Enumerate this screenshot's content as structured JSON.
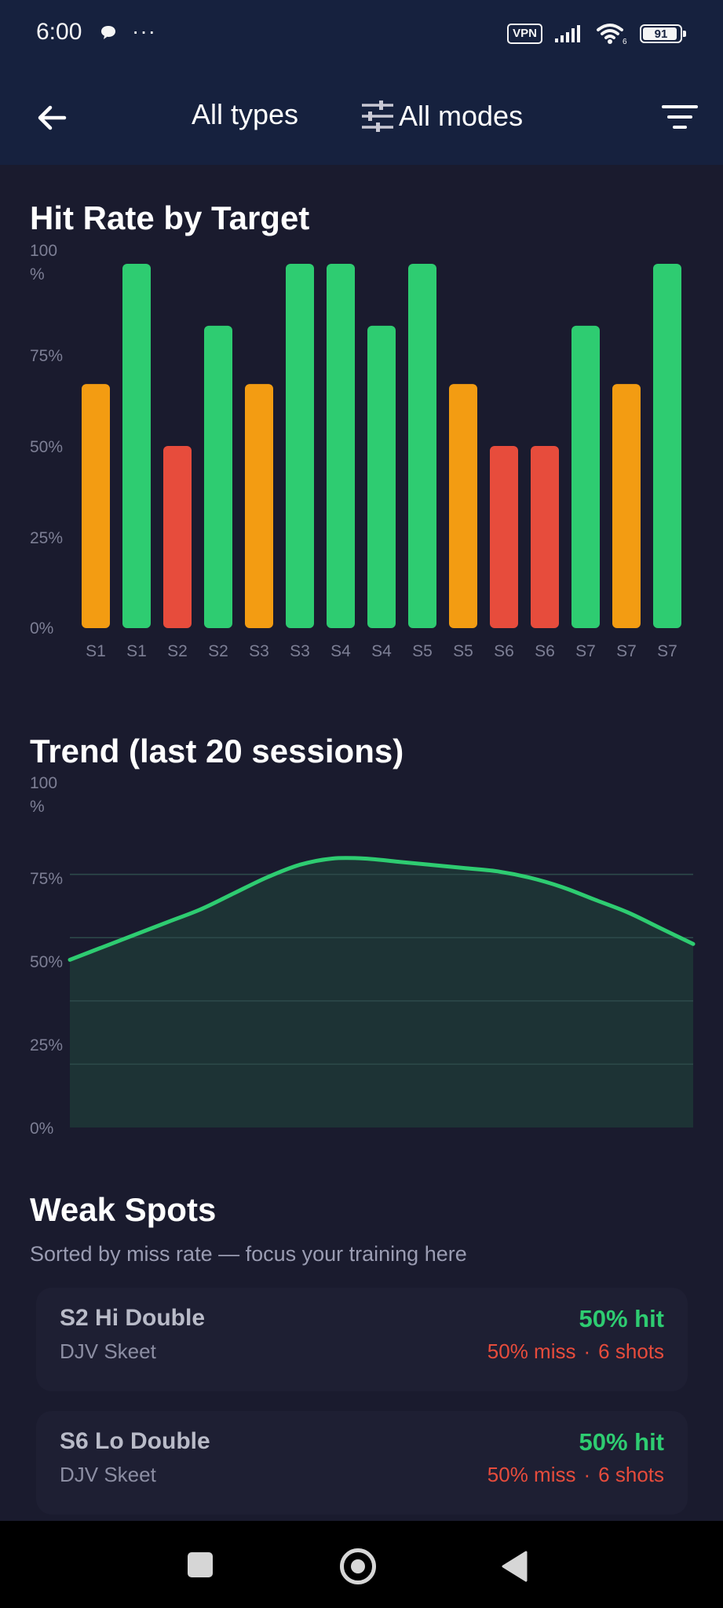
{
  "status_bar": {
    "time": "6:00",
    "icons": [
      "chat-bubble-icon",
      "more-dots-icon",
      "vpn-icon",
      "signal-icon",
      "wifi-icon",
      "battery-icon"
    ],
    "more": "···",
    "vpn": "VPN",
    "battery": "91"
  },
  "app_bar": {
    "type_filter": "All types",
    "mode_filter": "All modes",
    "icons": [
      "back-arrow-icon",
      "sliders-icon",
      "filter-icon"
    ]
  },
  "hit_rate": {
    "title": "Hit Rate by Target",
    "y_ticks": [
      "100\n%",
      "75%",
      "50%",
      "25%",
      "0%"
    ]
  },
  "trend": {
    "title": "Trend (last 20 sessions)",
    "y_ticks": [
      "100\n%",
      "75%",
      "50%",
      "25%",
      "0%"
    ]
  },
  "chart_data": [
    {
      "type": "bar",
      "title": "Hit Rate by Target",
      "categories": [
        "S1",
        "S1",
        "S2",
        "S2",
        "S3",
        "S3",
        "S4",
        "S4",
        "S5",
        "S5",
        "S6",
        "S6",
        "S7",
        "S7",
        "S7"
      ],
      "values": [
        67,
        100,
        50,
        83,
        67,
        100,
        100,
        83,
        100,
        67,
        50,
        50,
        83,
        67,
        100
      ],
      "colors": [
        "#f39c12",
        "#2ecc71",
        "#e74c3c",
        "#2ecc71",
        "#f39c12",
        "#2ecc71",
        "#2ecc71",
        "#2ecc71",
        "#2ecc71",
        "#f39c12",
        "#e74c3c",
        "#e74c3c",
        "#2ecc71",
        "#f39c12",
        "#2ecc71"
      ],
      "ylim": [
        0,
        100
      ],
      "y_unit": "%"
    },
    {
      "type": "area",
      "title": "Trend (last 20 sessions)",
      "x": [
        1,
        2,
        3,
        4,
        5,
        6,
        7,
        8,
        9,
        10,
        11,
        12,
        13,
        14,
        15,
        16,
        17,
        18,
        19,
        20
      ],
      "values": [
        53,
        57,
        61,
        65,
        69,
        74,
        79,
        83,
        85,
        85,
        84,
        83,
        82,
        81,
        79,
        76,
        72,
        68,
        63,
        58
      ],
      "ylim": [
        0,
        100
      ],
      "y_unit": "%",
      "line_color": "#2ecc71",
      "fill_color": "#1e3536",
      "grid": true
    }
  ],
  "weak_spots": {
    "title": "Weak Spots",
    "subtitle": "Sorted by miss rate — focus your training here",
    "items": [
      {
        "name": "S2 Hi Double",
        "type": "DJV Skeet",
        "hit": "50% hit",
        "miss": "50% miss",
        "shots": "6 shots"
      },
      {
        "name": "S6 Lo Double",
        "type": "DJV Skeet",
        "hit": "50% hit",
        "miss": "50% miss",
        "shots": "6 shots"
      }
    ]
  },
  "nav_bar": {
    "icons": [
      "recents-square-icon",
      "home-circle-icon",
      "back-triangle-icon"
    ]
  }
}
